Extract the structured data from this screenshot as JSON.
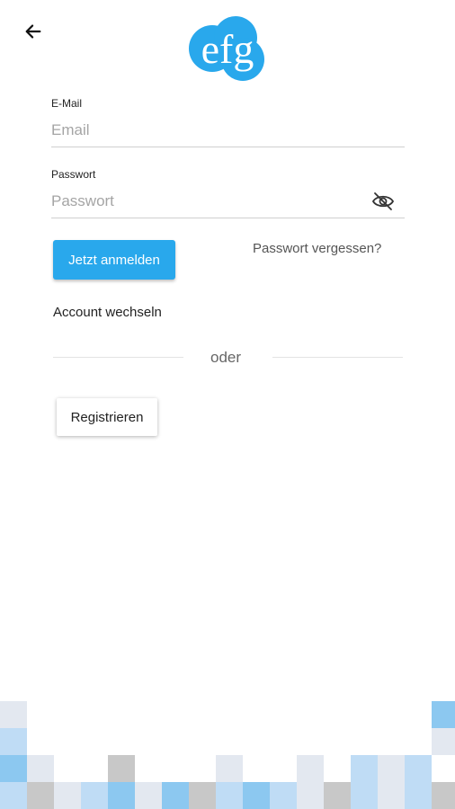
{
  "header": {
    "back_icon": "arrow-left-icon",
    "logo_text": "efg"
  },
  "email": {
    "label": "E-Mail",
    "placeholder": "Email",
    "value": ""
  },
  "password": {
    "label": "Passwort",
    "placeholder": "Passwort",
    "value": "",
    "toggle_icon": "eye-off-icon"
  },
  "actions": {
    "login_label": "Jetzt anmelden",
    "forgot_label": "Passwort vergessen?",
    "switch_account_label": "Account wechseln",
    "divider_text": "oder",
    "register_label": "Registrieren"
  },
  "colors": {
    "accent": "#29a8ec",
    "tile_light_blue": "#bfdcf5",
    "tile_blue": "#8cc8f0",
    "tile_gray": "#c8c8c8",
    "tile_light_gray": "#e3e8f0"
  }
}
